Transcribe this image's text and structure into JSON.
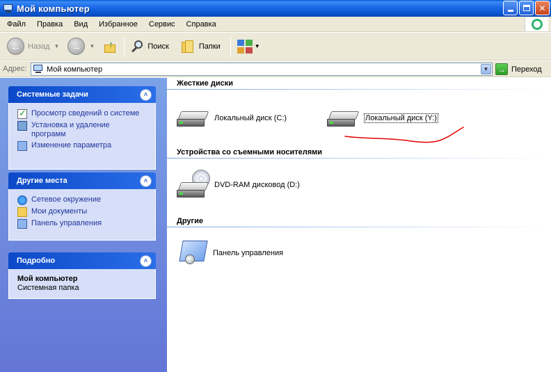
{
  "window": {
    "title": "Мой компьютер",
    "buttons": {
      "minimize": "",
      "maximize": "",
      "close": "✕"
    }
  },
  "menu": [
    "Файл",
    "Правка",
    "Вид",
    "Избранное",
    "Сервис",
    "Справка"
  ],
  "toolbar": {
    "back_label": "Назад",
    "search_label": "Поиск",
    "folders_label": "Папки"
  },
  "address": {
    "label": "Адрес:",
    "value": "Мой компьютер",
    "go_label": "Переход"
  },
  "taskpane": {
    "system_tasks": {
      "title": "Системные задачи",
      "items": [
        {
          "label": "Просмотр сведений о системе"
        },
        {
          "label": "Установка и удаление программ"
        },
        {
          "label": "Изменение параметра"
        }
      ]
    },
    "other_places": {
      "title": "Другие места",
      "items": [
        {
          "label": "Сетевое окружение"
        },
        {
          "label": "Мои документы"
        },
        {
          "label": "Панель управления"
        }
      ]
    },
    "details": {
      "title": "Подробно",
      "name": "Мой компьютер",
      "type": "Системная папка"
    }
  },
  "main": {
    "groups": [
      {
        "title": "Жесткие диски",
        "items": [
          {
            "label": "Локальный диск (C:)"
          },
          {
            "label": "Локальный диск (Y:)"
          }
        ]
      },
      {
        "title": "Устройства со съемными носителями",
        "items": [
          {
            "label": "DVD-RAM дисковод (D:)"
          }
        ]
      },
      {
        "title": "Другие",
        "items": [
          {
            "label": "Панель управления"
          }
        ]
      }
    ]
  },
  "colors": {
    "titlebar": "#0a55d0",
    "taskpane": "#7ba2e7",
    "link": "#21349e",
    "annotation": "#e00000"
  }
}
